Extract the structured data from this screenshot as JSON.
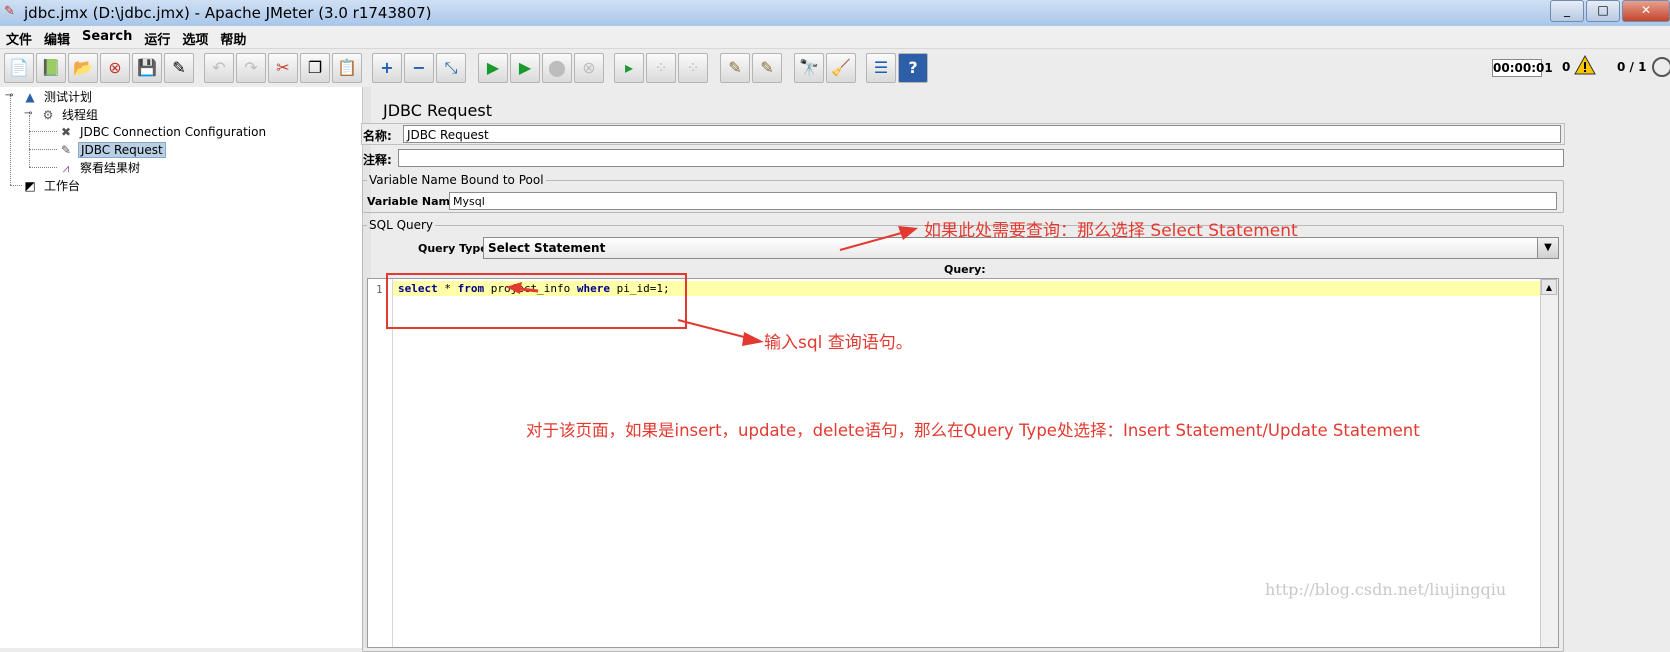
{
  "window": {
    "title": "jdbc.jmx (D:\\jdbc.jmx) - Apache JMeter (3.0 r1743807)"
  },
  "menu": [
    "文件",
    "编辑",
    "Search",
    "运行",
    "选项",
    "帮助"
  ],
  "toolbar": {
    "timer": "00:00:01",
    "error_count": "0",
    "threads": "0 / 1"
  },
  "tree": {
    "test_plan": "测试计划",
    "thread_group": "线程组",
    "jdbc_connection": "JDBC Connection Configuration",
    "jdbc_request": "JDBC Request",
    "result_tree": "察看结果树",
    "workbench": "工作台"
  },
  "panel": {
    "title": "JDBC Request",
    "name_label": "名称:",
    "name_value": "JDBC Request",
    "comment_label": "注释:",
    "comment_value": "",
    "pool_group": "Variable Name Bound to Pool",
    "variable_name_label": "Variable Name:",
    "variable_name_value": "Mysql",
    "sql_group": "SQL Query",
    "query_type_label": "Query Type:",
    "query_type_value": "Select Statement",
    "query_label": "Query:",
    "line_number": "1",
    "code": {
      "kw_select": "select",
      "star": " * ",
      "kw_from": "from",
      "table": " project_info ",
      "kw_where": "where",
      "condition": " pi_id=1;"
    }
  },
  "annotations": {
    "note_select": "如果此处需要查询：那么选择 Select Statement",
    "note_sql": "输入sql 查询语句。",
    "note_other": "对于该页面，如果是insert，update，delete语句，那么在Query Type处选择：Insert Statement/Update Statement"
  },
  "watermark": "http://blog.csdn.net/liujingqiu",
  "colors": {
    "annotation": "#e23a30",
    "selection": "#b8cfe5",
    "current_line": "#ffffaa"
  }
}
